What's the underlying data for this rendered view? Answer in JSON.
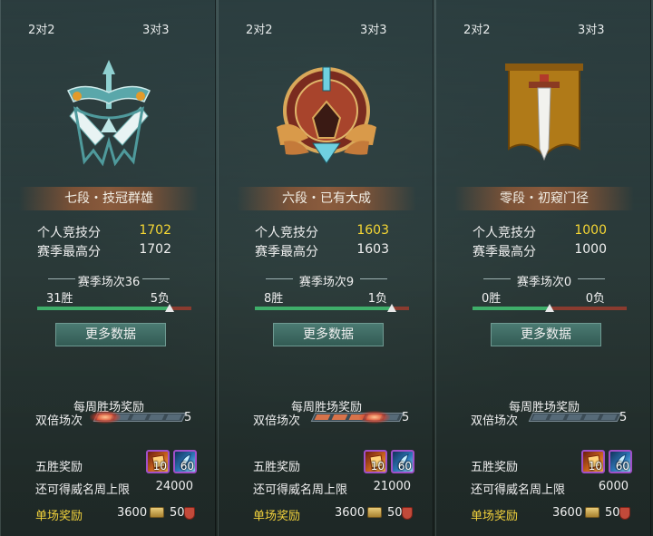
{
  "panels": [
    {
      "mode_left": "2对2",
      "mode_right": "3对3",
      "emblem": "crossed-swords-emblem",
      "rank_title": "七段・技冠群雄",
      "score_label": "个人竞技分",
      "score_value": "1702",
      "best_label": "赛季最高分",
      "best_value": "1702",
      "season_matches": "赛季场次36",
      "wins": "31胜",
      "losses": "5负",
      "win_fraction": 0.86,
      "more_button": "更多数据",
      "weekly_title": "每周胜场奖励",
      "double_label": "双倍场次",
      "double_count": "5",
      "double_filled": 1,
      "five_win_label": "五胜奖励",
      "item1_count": "10",
      "item2_count": "60",
      "fame_label": "还可得威名周上限",
      "fame_value": "24000",
      "single_label": "单场奖励",
      "single_coin": "3600",
      "single_badge": "50"
    },
    {
      "mode_left": "2对2",
      "mode_right": "3对3",
      "emblem": "winged-crest-emblem",
      "rank_title": "六段・已有大成",
      "score_label": "个人竞技分",
      "score_value": "1603",
      "best_label": "赛季最高分",
      "best_value": "1603",
      "season_matches": "赛季场次9",
      "wins": "8胜",
      "losses": "1负",
      "win_fraction": 0.89,
      "more_button": "更多数据",
      "weekly_title": "每周胜场奖励",
      "double_label": "双倍场次",
      "double_count": "5",
      "double_filled": 4,
      "five_win_label": "五胜奖励",
      "item1_count": "10",
      "item2_count": "60",
      "fame_label": "还可得威名周上限",
      "fame_value": "21000",
      "single_label": "单场奖励",
      "single_coin": "3600",
      "single_badge": "50"
    },
    {
      "mode_left": "2对2",
      "mode_right": "3对3",
      "emblem": "sword-banner-emblem",
      "rank_title": "零段・初窥门径",
      "score_label": "个人竞技分",
      "score_value": "1000",
      "best_label": "赛季最高分",
      "best_value": "1000",
      "season_matches": "赛季场次0",
      "wins": "0胜",
      "losses": "0负",
      "win_fraction": 0.5,
      "more_button": "更多数据",
      "weekly_title": "每周胜场奖励",
      "double_label": "双倍场次",
      "double_count": "5",
      "double_filled": 0,
      "five_win_label": "五胜奖励",
      "item1_count": "10",
      "item2_count": "60",
      "fame_label": "还可得威名周上限",
      "fame_value": "6000",
      "single_label": "单场奖励",
      "single_coin": "3600",
      "single_badge": "50"
    }
  ],
  "colors": {
    "score_highlight": "#f5d634",
    "win_bar": "#3fae6a",
    "loss_bar": "#8a3b2f",
    "single_reward_label": "#f2d23c",
    "rank_banner": "#c0683a"
  }
}
